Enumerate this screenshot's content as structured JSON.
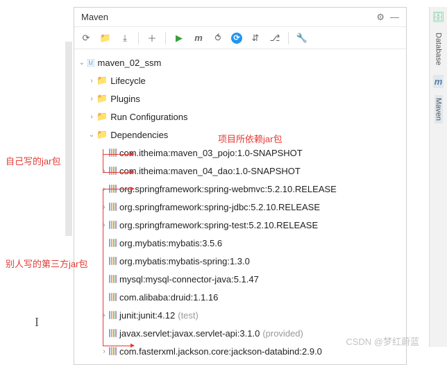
{
  "panel": {
    "title": "Maven"
  },
  "toolbar": {
    "m_label": "m"
  },
  "tree": {
    "root": "maven_02_ssm",
    "lifecycle": "Lifecycle",
    "plugins": "Plugins",
    "runconfig": "Run Configurations",
    "deps_label": "Dependencies",
    "deps": [
      "com.itheima:maven_03_pojo:1.0-SNAPSHOT",
      "com.itheima:maven_04_dao:1.0-SNAPSHOT",
      "org.springframework:spring-webmvc:5.2.10.RELEASE",
      "org.springframework:spring-jdbc:5.2.10.RELEASE",
      "org.springframework:spring-test:5.2.10.RELEASE",
      "org.mybatis:mybatis:3.5.6",
      "org.mybatis:mybatis-spring:1.3.0",
      "mysql:mysql-connector-java:5.1.47",
      "com.alibaba:druid:1.1.16",
      "junit:junit:4.12",
      "javax.servlet:javax.servlet-api:3.1.0",
      "com.fasterxml.jackson.core:jackson-databind:2.9.0"
    ],
    "scope_test": "(test)",
    "scope_provided": "(provided)"
  },
  "annotations": {
    "proj_deps": "项目所依赖jar包",
    "own_jars": "自己写的jar包",
    "third_party": "别人写的第三方jar包"
  },
  "side": {
    "database": "Database",
    "maven": "Maven"
  },
  "watermark": "CSDN @梦红蔚蓝"
}
